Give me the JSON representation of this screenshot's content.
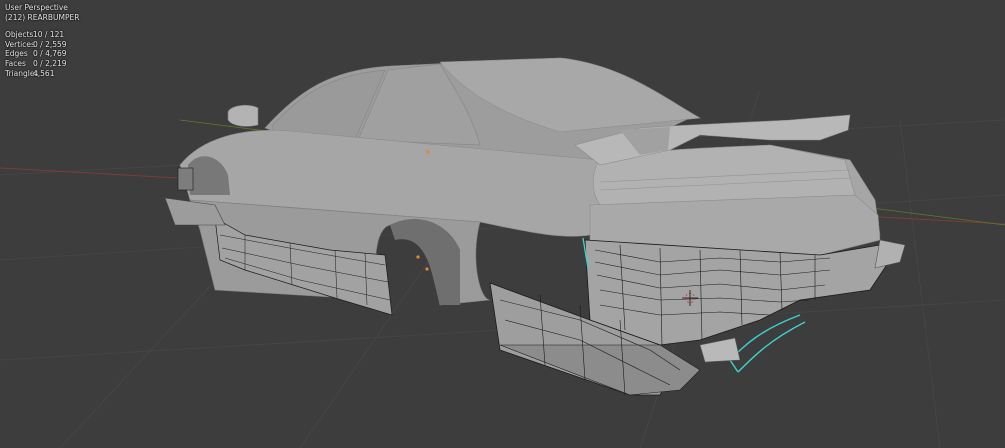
{
  "viewport": {
    "view_name": "User Perspective",
    "active_object": "(212) REARBUMPER"
  },
  "stats": [
    {
      "label": "Objects",
      "value": "10 / 121"
    },
    {
      "label": "Vertices",
      "value": "0 / 2,559"
    },
    {
      "label": "Edges",
      "value": "0 / 4,769"
    },
    {
      "label": "Faces",
      "value": "0 / 2,219"
    },
    {
      "label": "Triangles",
      "value": "4,561"
    }
  ],
  "colors": {
    "background": "#3d3d3d",
    "grid": "#4a4a4a",
    "x_axis": "#8a3a3a",
    "y_axis": "#6a8a2a",
    "body": "#a4a4a4",
    "body_dark": "#7a7a7a",
    "wire": "#1a1a1a",
    "selected": "#3fd0d0",
    "origin": "#e08a2a"
  }
}
